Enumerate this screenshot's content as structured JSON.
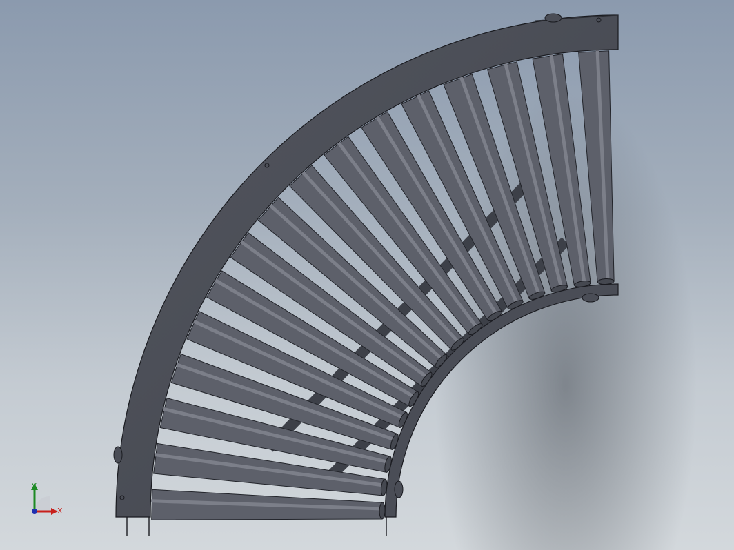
{
  "viewport": {
    "name": "cad-3d-viewport",
    "model": "curved-roller-conveyor",
    "color_frame": "#4b4e57",
    "color_roller": "#5f626c",
    "color_edge": "#1a1b20"
  },
  "triad": {
    "x_label": "X",
    "y_label": "Y",
    "x_color": "#c8201c",
    "y_color": "#1d8a24",
    "z_color": "#1f2fb0"
  }
}
